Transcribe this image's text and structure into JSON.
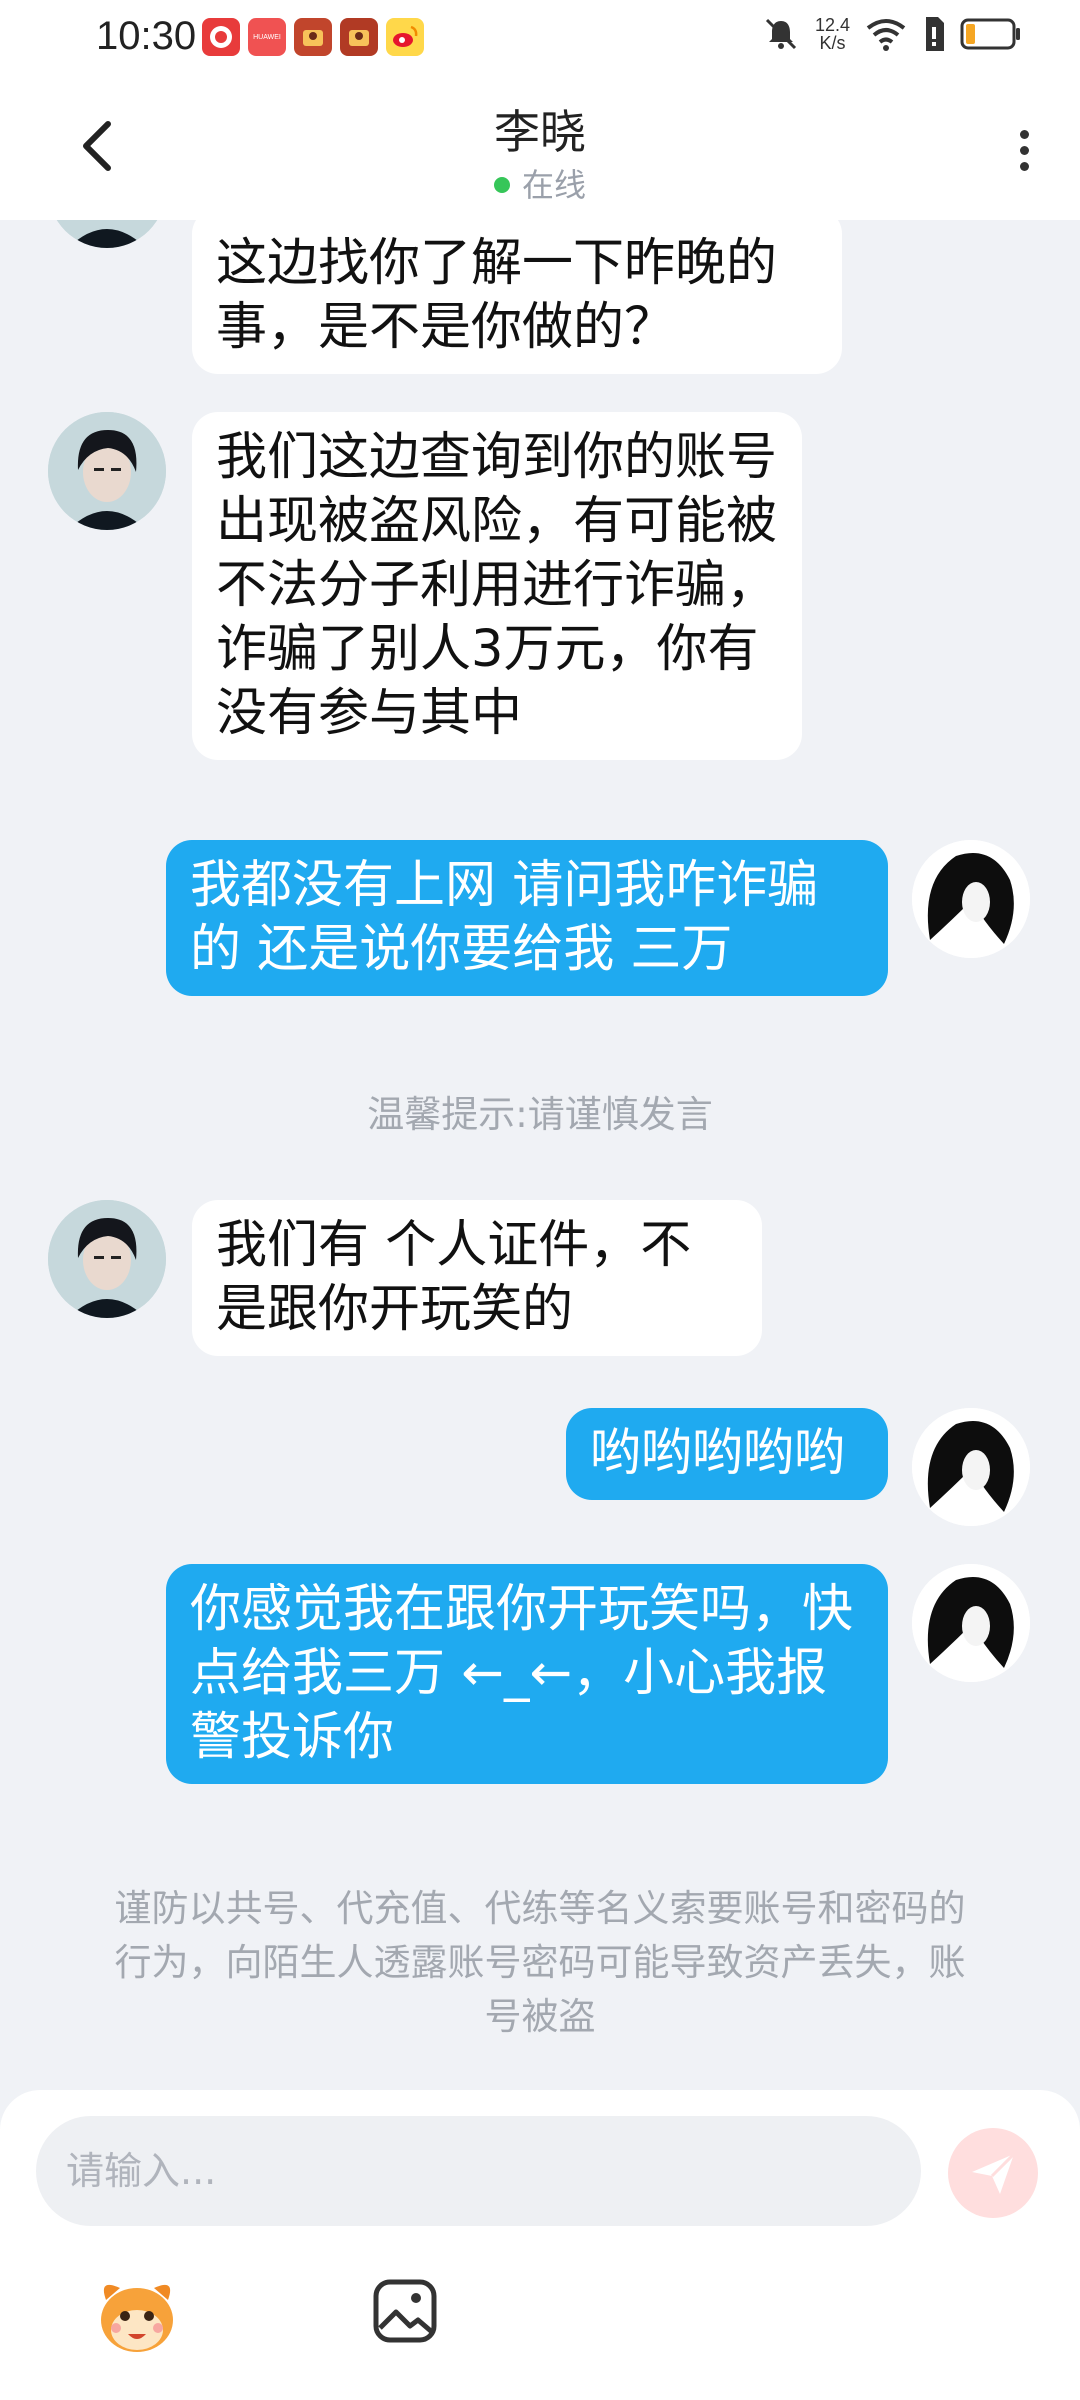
{
  "status_bar": {
    "time": "10:30",
    "net_speed_value": "12.4",
    "net_speed_unit": "K/s",
    "icons": [
      "red-app-icon",
      "huawei-app-icon",
      "game-app-icon",
      "game-app-icon",
      "weibo-icon",
      "mute-icon",
      "wifi-icon",
      "sim-icon",
      "battery-icon"
    ],
    "app_badge_small": "HUAWEI",
    "battery_level": 0.15
  },
  "header": {
    "title": "李晓",
    "status": "在线",
    "status_color": "#36c659"
  },
  "messages": [
    {
      "side": "in",
      "text": "这边找你了解一下昨晚的事，是不是你做的？"
    },
    {
      "side": "in",
      "text": "我们这边查询到你的账号出现被盗风险，有可能被不法分子利用进行诈骗，诈骗了别人3万元，你有没有参与其中"
    },
    {
      "side": "out",
      "text": "我都没有上网 请问我咋诈骗的 还是说你要给我 三万"
    },
    {
      "side": "in",
      "text": "我们有 个人证件，不是跟你开玩笑的"
    },
    {
      "side": "out",
      "text": "哟哟哟哟哟"
    },
    {
      "side": "out",
      "text": "你感觉我在跟你开玩笑吗，快点给我三万 ←_←，小心我报警投诉你"
    }
  ],
  "tip": "温馨提示:请谨慎发言",
  "warning": "谨防以共号、代充值、代练等名义索要账号和密码的行为，向陌生人透露账号密码可能导致资产丢失，账号被盗",
  "input": {
    "placeholder": "请输入..."
  },
  "colors": {
    "outgoing_bubble": "#1faaf0",
    "incoming_bubble": "#ffffff",
    "background": "#f0f2f6",
    "send_button": "#ffdede"
  }
}
